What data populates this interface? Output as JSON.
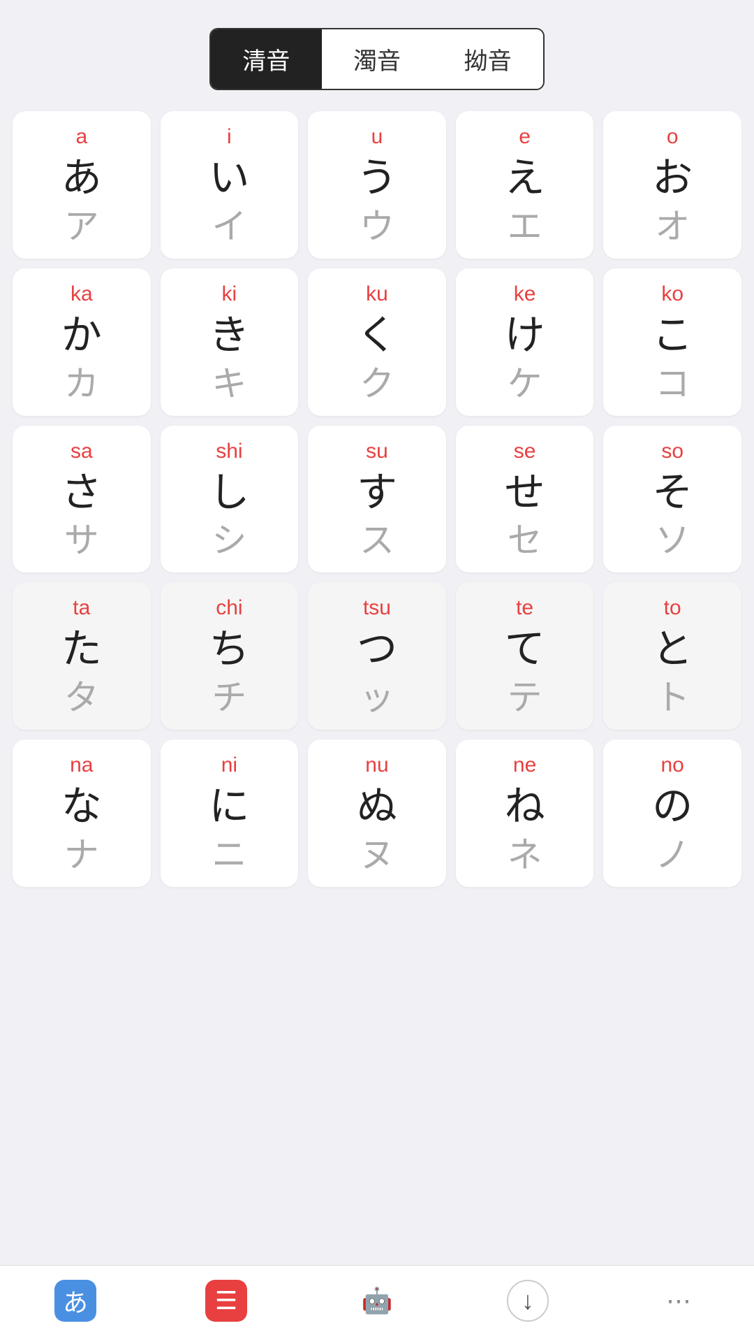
{
  "tabs": [
    {
      "id": "seion",
      "label": "清音",
      "active": true
    },
    {
      "id": "dakuon",
      "label": "濁音",
      "active": false
    },
    {
      "id": "youon",
      "label": "拗音",
      "active": false
    }
  ],
  "grid": [
    {
      "romaji": "a",
      "hiragana": "あ",
      "katakana": "ア",
      "highlighted": false
    },
    {
      "romaji": "i",
      "hiragana": "い",
      "katakana": "イ",
      "highlighted": false
    },
    {
      "romaji": "u",
      "hiragana": "う",
      "katakana": "ウ",
      "highlighted": false
    },
    {
      "romaji": "e",
      "hiragana": "え",
      "katakana": "エ",
      "highlighted": false
    },
    {
      "romaji": "o",
      "hiragana": "お",
      "katakana": "オ",
      "highlighted": false
    },
    {
      "romaji": "ka",
      "hiragana": "か",
      "katakana": "カ",
      "highlighted": false
    },
    {
      "romaji": "ki",
      "hiragana": "き",
      "katakana": "キ",
      "highlighted": false
    },
    {
      "romaji": "ku",
      "hiragana": "く",
      "katakana": "ク",
      "highlighted": false
    },
    {
      "romaji": "ke",
      "hiragana": "け",
      "katakana": "ケ",
      "highlighted": false
    },
    {
      "romaji": "ko",
      "hiragana": "こ",
      "katakana": "コ",
      "highlighted": false
    },
    {
      "romaji": "sa",
      "hiragana": "さ",
      "katakana": "サ",
      "highlighted": false
    },
    {
      "romaji": "shi",
      "hiragana": "し",
      "katakana": "シ",
      "highlighted": false
    },
    {
      "romaji": "su",
      "hiragana": "す",
      "katakana": "ス",
      "highlighted": false
    },
    {
      "romaji": "se",
      "hiragana": "せ",
      "katakana": "セ",
      "highlighted": false
    },
    {
      "romaji": "so",
      "hiragana": "そ",
      "katakana": "ソ",
      "highlighted": false
    },
    {
      "romaji": "ta",
      "hiragana": "た",
      "katakana": "タ",
      "highlighted": true
    },
    {
      "romaji": "chi",
      "hiragana": "ち",
      "katakana": "チ",
      "highlighted": true
    },
    {
      "romaji": "tsu",
      "hiragana": "つ",
      "katakana": "ッ",
      "highlighted": true
    },
    {
      "romaji": "te",
      "hiragana": "て",
      "katakana": "テ",
      "highlighted": true
    },
    {
      "romaji": "to",
      "hiragana": "と",
      "katakana": "ト",
      "highlighted": true
    },
    {
      "romaji": "na",
      "hiragana": "な",
      "katakana": "ナ",
      "highlighted": false
    },
    {
      "romaji": "ni",
      "hiragana": "に",
      "katakana": "ニ",
      "highlighted": false
    },
    {
      "romaji": "nu",
      "hiragana": "ぬ",
      "katakana": "ヌ",
      "highlighted": false
    },
    {
      "romaji": "ne",
      "hiragana": "ね",
      "katakana": "ネ",
      "highlighted": false
    },
    {
      "romaji": "no",
      "hiragana": "の",
      "katakana": "ノ",
      "highlighted": false
    }
  ],
  "nav": {
    "items": [
      {
        "id": "hiragana",
        "icon": "あ",
        "style": "blue-bg"
      },
      {
        "id": "list",
        "icon": "☰",
        "style": "red-bg"
      },
      {
        "id": "robot",
        "icon": "🤖",
        "style": "plain"
      },
      {
        "id": "down",
        "icon": "↓",
        "style": "outline"
      },
      {
        "id": "more",
        "icon": "⋯",
        "style": "plain"
      }
    ]
  }
}
